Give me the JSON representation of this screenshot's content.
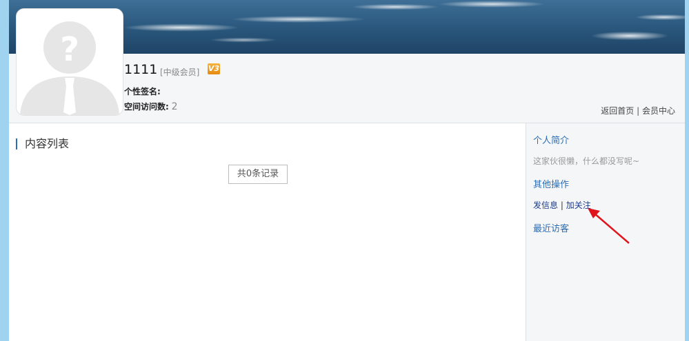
{
  "profile": {
    "username": "1111",
    "level": "[中级会员]",
    "vip_badge": "V3",
    "signature_label": "个性签名:",
    "visits_label": "空间访问数:",
    "visits_count": "2",
    "avatar_icon": "default-avatar-icon"
  },
  "top_links": {
    "home": "返回首页",
    "separator": "|",
    "member_center": "会员中心"
  },
  "main": {
    "section_title": "内容列表",
    "record_count": "共0条记录"
  },
  "sidebar": {
    "intro_title": "个人简介",
    "intro_text": "这家伙很懒，什么都没写呢~",
    "ops_title": "其他操作",
    "send_message": "发信息",
    "separator": "|",
    "follow": "加关注",
    "visitors_title": "最近访客"
  },
  "colors": {
    "background": "#9fd3f0",
    "link_blue": "#2a6db5",
    "annotation_arrow": "#e0141c"
  }
}
